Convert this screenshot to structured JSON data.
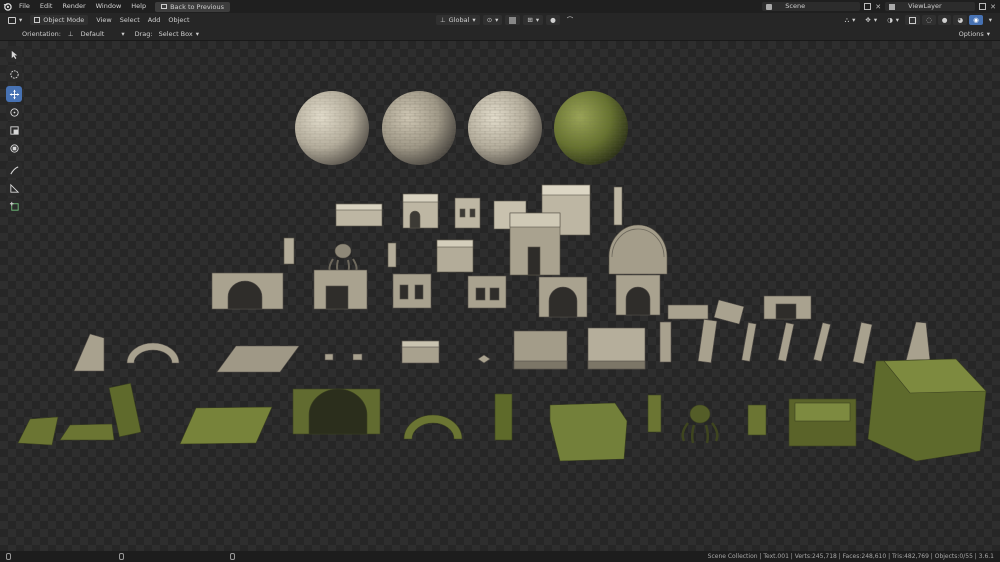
{
  "topbar": {
    "menus": [
      "File",
      "Edit",
      "Render",
      "Window",
      "Help"
    ],
    "back_button": "Back to Previous",
    "scene_name": "Scene",
    "view_layer": "ViewLayer"
  },
  "header": {
    "mode": "Object Mode",
    "menus": [
      "View",
      "Select",
      "Add",
      "Object"
    ],
    "transform_orientation": "Global"
  },
  "header2": {
    "orientation_label": "Orientation:",
    "orientation_value": "Default",
    "drag_label": "Drag:",
    "drag_value": "Select Box",
    "options_label": "Options"
  },
  "toolbar": {
    "tools": [
      "select-box",
      "cursor",
      "move",
      "rotate",
      "scale",
      "transform",
      "annotate",
      "measure",
      "add-cube"
    ],
    "active": "move"
  },
  "statusbar": {
    "stats": "Scene Collection | Text.001 | Verts:245,718 | Faces:248,610 | Tris:482,769 | Objects:0/55 | 3.6.1"
  },
  "colors": {
    "accent": "#4772b3",
    "viewport_bg": "#2e2e2e",
    "stone": "#bfb8a6",
    "moss": "#6f7d36"
  }
}
